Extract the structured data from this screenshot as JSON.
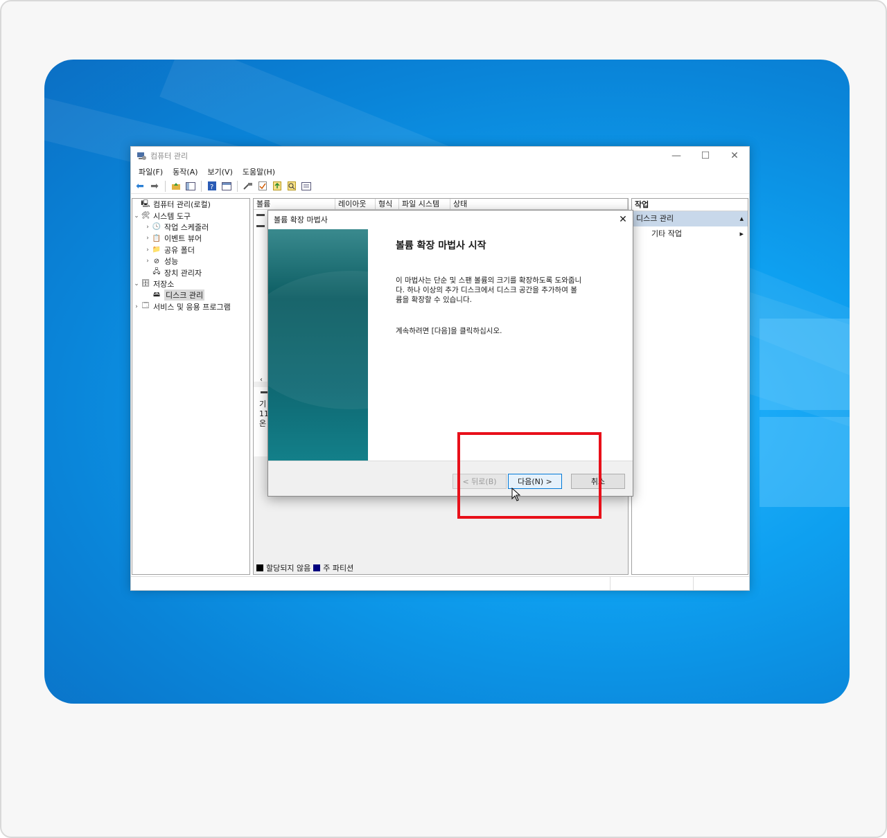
{
  "window": {
    "title": "컴퓨터 관리",
    "min_glyph": "—",
    "max_glyph": "☐",
    "close_glyph": "✕"
  },
  "menu": [
    "파일(F)",
    "동작(A)",
    "보기(V)",
    "도움말(H)"
  ],
  "tree": {
    "root": "컴퓨터 관리(로컬)",
    "system_tools": "시스템 도구",
    "task_scheduler": "작업 스케줄러",
    "event_viewer": "이벤트 뷰어",
    "shared_folders": "공유 폴더",
    "performance": "성능",
    "device_manager": "장치 관리자",
    "storage": "저장소",
    "disk_management": "디스크 관리",
    "services_apps": "서비스 및 응용 프로그램"
  },
  "volume_list": {
    "columns": [
      "볼륨",
      "레이아웃",
      "형식",
      "파일 시스템",
      "상태"
    ]
  },
  "disk_panel": {
    "line1": "기",
    "line2": "11",
    "line3": "온"
  },
  "legend": {
    "unallocated": "할당되지 않음",
    "primary": "주 파티션",
    "unallocated_color": "#000000",
    "primary_color": "#00007f"
  },
  "actions": {
    "header": "작업",
    "group": "디스크 관리",
    "item": "기타 작업"
  },
  "dialog": {
    "title": "볼륨 확장 마법사",
    "close_glyph": "✕",
    "heading": "볼륨 확장 마법사 시작",
    "desc_line1": "이 마법사는 단순 및 스팬 볼륨의 크기를 확장하도록 도와줍니",
    "desc_line2": "다. 하나 이상의 추가 디스크에서 디스크 공간을 추가하여 볼",
    "desc_line3": "륨을 확장할 수 있습니다.",
    "continue_text": "계속하려면 [다음]을 클릭하십시오.",
    "back_button": "< 뒤로(B)",
    "next_button": "다음(N) >",
    "cancel_button": "취소"
  },
  "colors": {
    "desktop_blue": "#0ea0f0",
    "highlight_red": "#e8101a",
    "wizard_teal": "#0b5c62"
  }
}
